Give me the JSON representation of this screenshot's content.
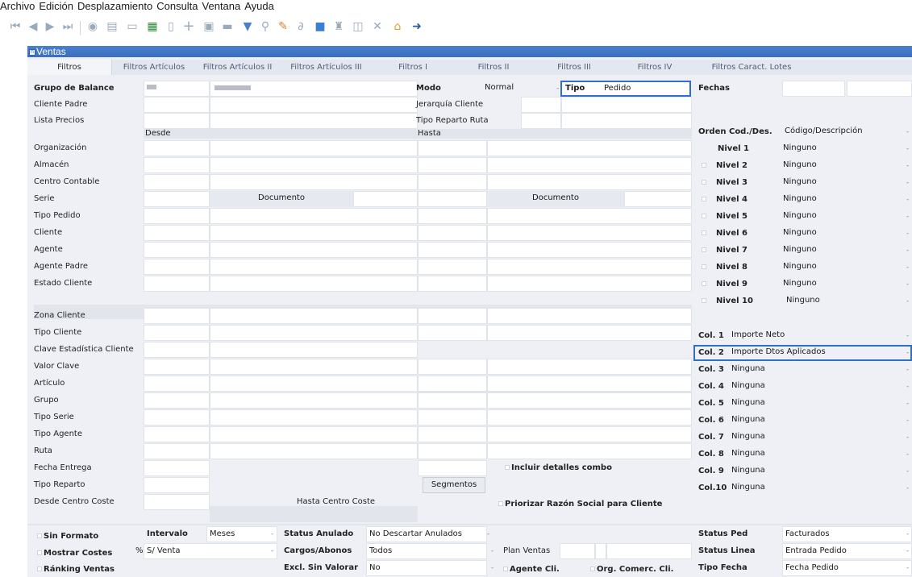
{
  "menu": [
    "Archivo",
    "Edición",
    "Desplazamiento",
    "Consulta",
    "Ventana",
    "Ayuda"
  ],
  "window": {
    "title": "Ventas"
  },
  "tabs": [
    "Filtros",
    "Filtros Artículos",
    "Filtros Artículos II",
    "Filtros Artículos III",
    "Filtros I",
    "Filtros II",
    "Filtros III",
    "Filtros IV",
    "Filtros Caract. Lotes"
  ],
  "top": {
    "grupo_balance": "Grupo de Balance",
    "modo": "Modo",
    "modo_val": "Normal",
    "tipo": "Tipo",
    "tipo_val": "Pedido",
    "fechas": "Fechas",
    "cliente_padre": "Cliente Padre",
    "jerarquia": "Jerarquía Cliente",
    "lista_precios": "Lista Precios",
    "tipo_reparto_ruta": "Tipo Reparto Ruta",
    "desde": "Desde",
    "hasta": "Hasta",
    "documento": "Documento",
    "incluir": "Incluir detalles combo",
    "segmentos": "Segmentos",
    "hasta_cc": "Hasta Centro Coste",
    "priorizar": "Priorizar Razón Social para Cliente"
  },
  "left_labels": [
    "Organización",
    "Almacén",
    "Centro Contable",
    "Serie",
    "Tipo Pedido",
    "Cliente",
    "Agente",
    "Agente Padre",
    "Estado Cliente",
    "Zona Cliente",
    "Tipo Cliente",
    "Clave Estadística Cliente",
    "Valor Clave",
    "Artículo",
    "Grupo",
    "Tipo Serie",
    "Tipo Agente",
    "Ruta",
    "Fecha Entrega",
    "Tipo Reparto",
    "Desde Centro Coste"
  ],
  "right": {
    "orden_label": "Orden Cod./Des.",
    "orden_val": "Código/Descripción",
    "niveles": [
      {
        "l": "Nivel 1",
        "v": "Ninguno"
      },
      {
        "l": "Nivel 2",
        "v": "Ninguno"
      },
      {
        "l": "Nivel 3",
        "v": "Ninguno"
      },
      {
        "l": "Nivel 4",
        "v": "Ninguno"
      },
      {
        "l": "Nivel 5",
        "v": "Ninguno"
      },
      {
        "l": "Nivel 6",
        "v": "Ninguno"
      },
      {
        "l": "Nivel 7",
        "v": "Ninguno"
      },
      {
        "l": "Nivel 8",
        "v": "Ninguno"
      },
      {
        "l": "Nivel 9",
        "v": "Ninguno"
      },
      {
        "l": "Nivel 10",
        "v": "Ninguno"
      }
    ],
    "cols": [
      {
        "l": "Col. 1",
        "v": "Importe Neto"
      },
      {
        "l": "Col. 2",
        "v": "Importe Dtos Aplicados"
      },
      {
        "l": "Col. 3",
        "v": "Ninguna"
      },
      {
        "l": "Col. 4",
        "v": "Ninguna"
      },
      {
        "l": "Col. 5",
        "v": "Ninguna"
      },
      {
        "l": "Col. 6",
        "v": "Ninguna"
      },
      {
        "l": "Col. 7",
        "v": "Ninguna"
      },
      {
        "l": "Col. 8",
        "v": "Ninguna"
      },
      {
        "l": "Col. 9",
        "v": "Ninguna"
      },
      {
        "l": "Col.10",
        "v": "Ninguna"
      }
    ]
  },
  "bottom": {
    "sin_formato": "Sin Formato",
    "intervalo": "Intervalo",
    "intervalo_val": "Meses",
    "status_anulado": "Status Anulado",
    "status_anulado_val": "No Descartar Anulados",
    "status_ped": "Status Ped",
    "status_ped_val": "Facturados",
    "mostrar_costes": "Mostrar Costes",
    "pct": "%",
    "pct_val": "S/ Venta",
    "cargos": "Cargos/Abonos",
    "cargos_val": "Todos",
    "plan_ventas": "Plan Ventas",
    "status_linea": "Status Linea",
    "status_linea_val": "Entrada Pedido",
    "ranking": "Ránking Ventas",
    "excl": "Excl. Sin Valorar",
    "excl_val": "No",
    "agente_cli": "Agente Cli.",
    "org_comerc": "Org. Comerc. Cli.",
    "tipo_fecha": "Tipo Fecha",
    "tipo_fecha_val": "Fecha Pedido"
  }
}
